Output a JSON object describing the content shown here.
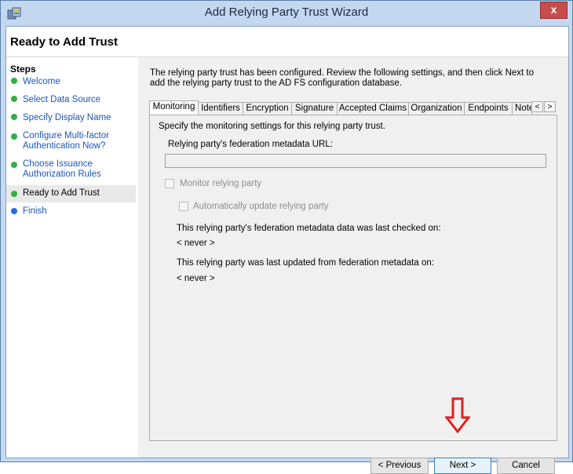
{
  "window": {
    "title": "Add Relying Party Trust Wizard",
    "close_glyph": "x"
  },
  "header": {
    "title": "Ready to Add Trust"
  },
  "steps": {
    "heading": "Steps",
    "items": [
      {
        "label": "Welcome",
        "state": "done"
      },
      {
        "label": "Select Data Source",
        "state": "done"
      },
      {
        "label": "Specify Display Name",
        "state": "done"
      },
      {
        "label": "Configure Multi-factor Authentication Now?",
        "state": "done"
      },
      {
        "label": "Choose Issuance Authorization Rules",
        "state": "done"
      },
      {
        "label": "Ready to Add Trust",
        "state": "current"
      },
      {
        "label": "Finish",
        "state": "pending"
      }
    ]
  },
  "intro": "The relying party trust has been configured. Review the following settings, and then click Next to add the relying party trust to the AD FS configuration database.",
  "tabs": {
    "items": [
      "Monitoring",
      "Identifiers",
      "Encryption",
      "Signature",
      "Accepted Claims",
      "Organization",
      "Endpoints",
      "Note"
    ],
    "active": "Monitoring",
    "scroll_left": "<",
    "scroll_right": ">"
  },
  "monitoring": {
    "description": "Specify the monitoring settings for this relying party trust.",
    "url_label": "Relying party's federation metadata URL:",
    "url_value": "",
    "monitor_label": "Monitor relying party",
    "auto_update_label": "Automatically update relying party",
    "last_checked_label": "This relying party's federation metadata data was last checked on:",
    "last_checked_value": "< never >",
    "last_updated_label": "This relying party was last updated from federation metadata on:",
    "last_updated_value": "< never >"
  },
  "buttons": {
    "previous": "< Previous",
    "next": "Next >",
    "cancel": "Cancel"
  },
  "colors": {
    "accent": "#1a56b8",
    "done": "#2fb144",
    "pending": "#1f6fe0",
    "arrow": "#e02020"
  }
}
